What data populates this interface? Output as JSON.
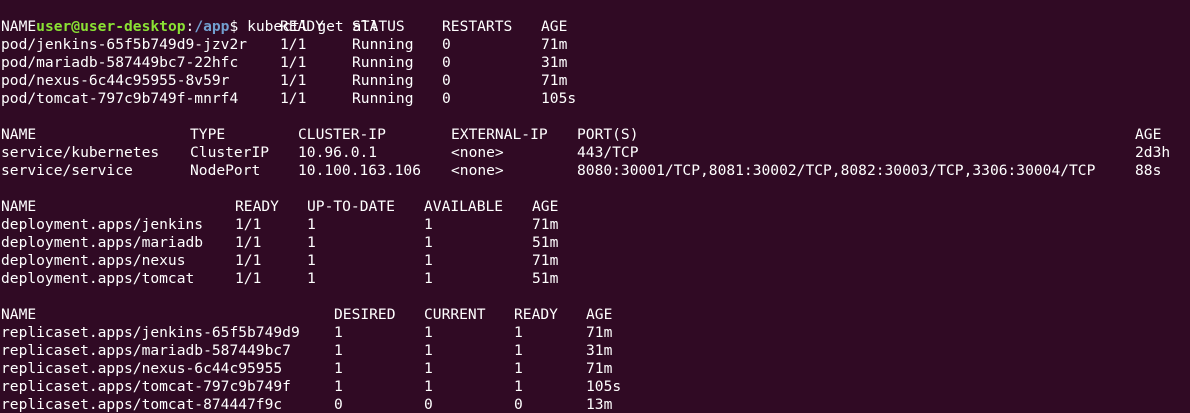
{
  "prompt": {
    "user_host": "user@user-desktop",
    "separator": ":",
    "path": "/app",
    "symbol": "$",
    "command": " kubectl get all"
  },
  "pods": {
    "headers": [
      "NAME",
      "READY",
      "STATUS",
      "RESTARTS",
      "AGE"
    ],
    "rows": [
      [
        "pod/jenkins-65f5b749d9-jzv2r",
        "1/1",
        "Running",
        "0",
        "71m"
      ],
      [
        "pod/mariadb-587449bc7-22hfc",
        "1/1",
        "Running",
        "0",
        "31m"
      ],
      [
        "pod/nexus-6c44c95955-8v59r",
        "1/1",
        "Running",
        "0",
        "71m"
      ],
      [
        "pod/tomcat-797c9b749f-mnrf4",
        "1/1",
        "Running",
        "0",
        "105s"
      ]
    ]
  },
  "services": {
    "headers": [
      "NAME",
      "TYPE",
      "CLUSTER-IP",
      "EXTERNAL-IP",
      "PORT(S)",
      "AGE"
    ],
    "rows": [
      [
        "service/kubernetes",
        "ClusterIP",
        "10.96.0.1",
        "<none>",
        "443/TCP",
        "2d3h"
      ],
      [
        "service/service",
        "NodePort",
        "10.100.163.106",
        "<none>",
        "8080:30001/TCP,8081:30002/TCP,8082:30003/TCP,3306:30004/TCP",
        "88s"
      ]
    ]
  },
  "deployments": {
    "headers": [
      "NAME",
      "READY",
      "UP-TO-DATE",
      "AVAILABLE",
      "AGE"
    ],
    "rows": [
      [
        "deployment.apps/jenkins",
        "1/1",
        "1",
        "1",
        "71m"
      ],
      [
        "deployment.apps/mariadb",
        "1/1",
        "1",
        "1",
        "51m"
      ],
      [
        "deployment.apps/nexus",
        "1/1",
        "1",
        "1",
        "71m"
      ],
      [
        "deployment.apps/tomcat",
        "1/1",
        "1",
        "1",
        "51m"
      ]
    ]
  },
  "replicasets": {
    "headers": [
      "NAME",
      "DESIRED",
      "CURRENT",
      "READY",
      "AGE"
    ],
    "rows": [
      [
        "replicaset.apps/jenkins-65f5b749d9",
        "1",
        "1",
        "1",
        "71m"
      ],
      [
        "replicaset.apps/mariadb-587449bc7",
        "1",
        "1",
        "1",
        "31m"
      ],
      [
        "replicaset.apps/nexus-6c44c95955",
        "1",
        "1",
        "1",
        "71m"
      ],
      [
        "replicaset.apps/tomcat-797c9b749f",
        "1",
        "1",
        "1",
        "105s"
      ],
      [
        "replicaset.apps/tomcat-874447f9c",
        "0",
        "0",
        "0",
        "13m"
      ]
    ]
  }
}
